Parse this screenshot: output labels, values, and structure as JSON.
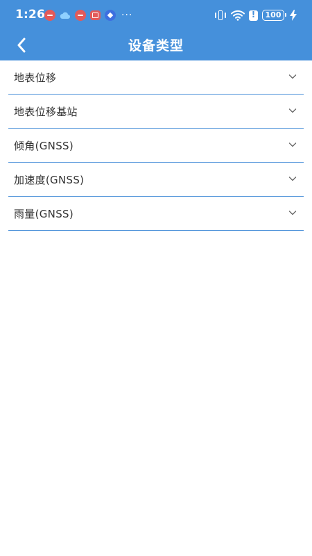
{
  "status_bar": {
    "time": "1:26",
    "more": "···",
    "battery": "100",
    "notification_icons": [
      "red-app-notification-icon",
      "cloud-notification-icon",
      "red-app-notification-icon",
      "book-notification-icon",
      "blue-app-notification-icon"
    ]
  },
  "header": {
    "title": "设备类型",
    "background_color": "#4590DB"
  },
  "list": {
    "divider_color": "#4A90D9",
    "items": [
      {
        "label": "地表位移"
      },
      {
        "label": "地表位移基站"
      },
      {
        "label": "倾角(GNSS)"
      },
      {
        "label": "加速度(GNSS)"
      },
      {
        "label": "雨量(GNSS)"
      }
    ]
  }
}
